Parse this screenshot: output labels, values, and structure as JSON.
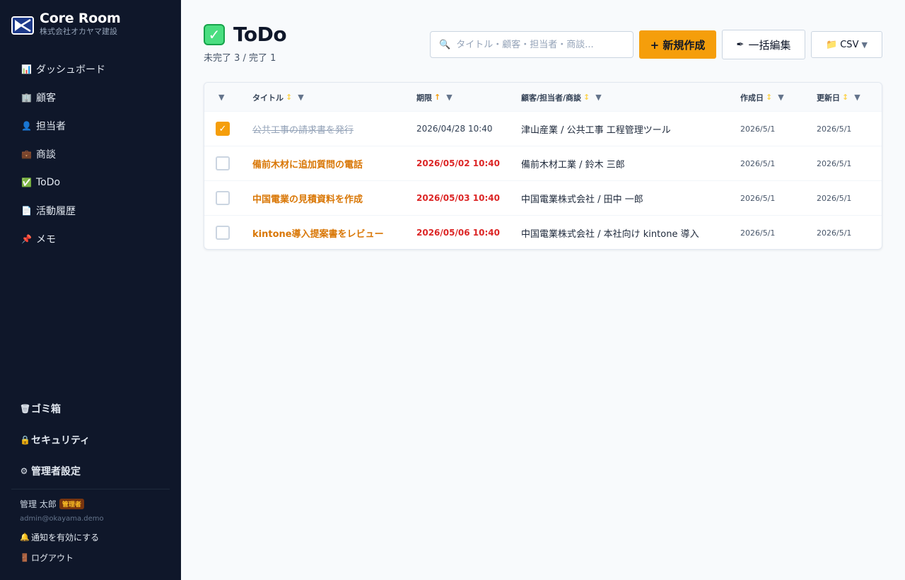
{
  "brand": {
    "title": "Core Room",
    "subtitle": "株式会社オカヤマ建設"
  },
  "nav": [
    {
      "icon": "📊",
      "label": "ダッシュボード",
      "icon_name": "chart-icon"
    },
    {
      "icon": "🏢",
      "label": "顧客",
      "icon_name": "building-icon"
    },
    {
      "icon": "👤",
      "label": "担当者",
      "icon_name": "person-icon"
    },
    {
      "icon": "💼",
      "label": "商談",
      "icon_name": "briefcase-icon"
    },
    {
      "icon": "✅",
      "label": "ToDo",
      "icon_name": "checkmark-icon"
    },
    {
      "icon": "📄",
      "label": "活動履歴",
      "icon_name": "document-icon"
    },
    {
      "icon": "📌",
      "label": "メモ",
      "icon_name": "pin-icon"
    }
  ],
  "bottom_nav": [
    {
      "icon": "🗑",
      "label": "ゴミ箱",
      "icon_name": "trash-icon"
    },
    {
      "icon": "🔒",
      "label": "セキュリティ",
      "icon_name": "lock-icon"
    },
    {
      "icon": "⚙",
      "label": "管理者設定",
      "icon_name": "gear-icon"
    }
  ],
  "user": {
    "name": "管理 太郎",
    "role_badge": "管理者",
    "email": "admin@okayama.demo",
    "notify_label": "通知を有効にする",
    "logout_label": "ログアウト"
  },
  "page": {
    "title": "ToDo",
    "count": "未完了 3 / 完了 1"
  },
  "toolbar": {
    "search_placeholder": "タイトル・顧客・担当者・商談...",
    "new_label": "+ 新規作成",
    "bulk_label": "一括編集",
    "csv_label": "CSV"
  },
  "table": {
    "headers": {
      "title": "タイトル",
      "due": "期限",
      "customer": "顧客/担当者/商談",
      "created": "作成日",
      "updated": "更新日"
    },
    "rows": [
      {
        "done": true,
        "title": "公共工事の請求書を発行",
        "due": "2026/04/28 10:40",
        "overdue": false,
        "customer": "津山産業 / 公共工事 工程管理ツール",
        "created": "2026/5/1",
        "updated": "2026/5/1"
      },
      {
        "done": false,
        "title": "備前木材に追加質問の電話",
        "due": "2026/05/02 10:40",
        "overdue": true,
        "customer": "備前木材工業 / 鈴木 三郎",
        "created": "2026/5/1",
        "updated": "2026/5/1"
      },
      {
        "done": false,
        "title": "中国電業の見積資料を作成",
        "due": "2026/05/03 10:40",
        "overdue": true,
        "customer": "中国電業株式会社 / 田中 一郎",
        "created": "2026/5/1",
        "updated": "2026/5/1"
      },
      {
        "done": false,
        "title": "kintone導入提案書をレビュー",
        "due": "2026/05/06 10:40",
        "overdue": true,
        "customer": "中国電業株式会社 / 本社向け kintone 導入",
        "created": "2026/5/1",
        "updated": "2026/5/1"
      }
    ]
  },
  "colors": {
    "accent": "#f59e0b",
    "sidebar": "#0f172a",
    "overdue": "#dc2626"
  }
}
